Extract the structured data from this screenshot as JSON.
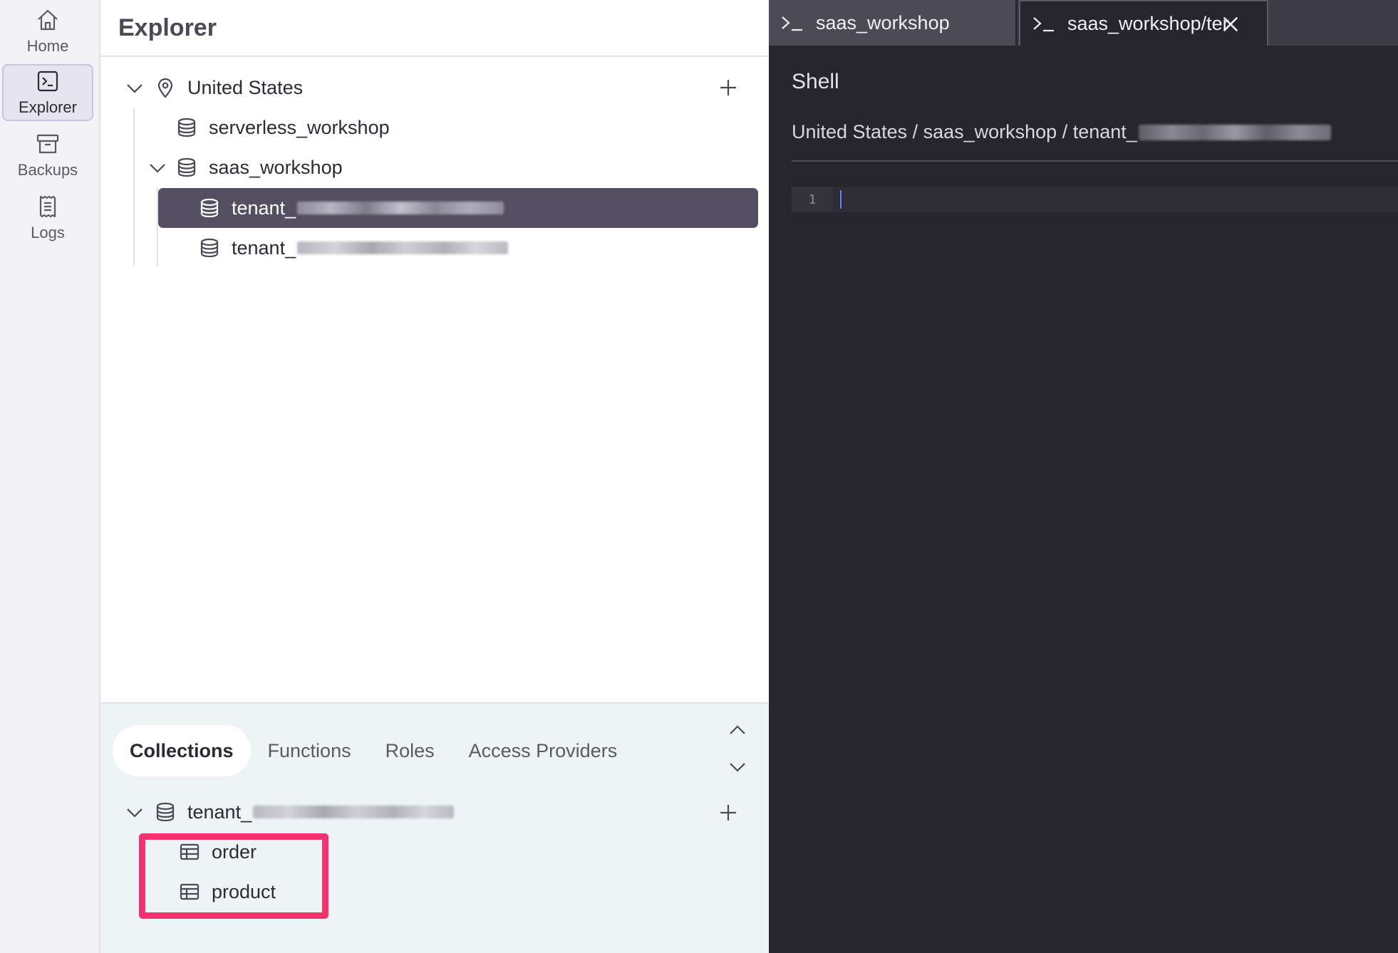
{
  "rail": {
    "items": [
      {
        "label": "Home",
        "icon": "home-icon"
      },
      {
        "label": "Explorer",
        "icon": "terminal-icon",
        "active": true
      },
      {
        "label": "Backups",
        "icon": "archive-icon"
      },
      {
        "label": "Logs",
        "icon": "receipt-icon"
      }
    ]
  },
  "explorer": {
    "title": "Explorer",
    "region": {
      "label": "United States",
      "icon": "location-pin-icon"
    },
    "databases": [
      {
        "label": "serverless_workshop",
        "icon": "database-icon"
      },
      {
        "label": "saas_workshop",
        "icon": "database-icon",
        "expanded": true
      }
    ],
    "tenants": [
      {
        "label": "tenant_",
        "selected": true
      },
      {
        "label": "tenant_",
        "selected": false
      }
    ]
  },
  "bottom": {
    "tabs": [
      "Collections",
      "Functions",
      "Roles",
      "Access Providers"
    ],
    "active_tab": "Collections",
    "db_label": "tenant_",
    "collections": [
      {
        "label": "order",
        "icon": "table-icon"
      },
      {
        "label": "product",
        "icon": "table-icon"
      }
    ],
    "highlight_color": "#f0346f"
  },
  "shell": {
    "tabs": [
      {
        "label": "saas_workshop"
      },
      {
        "label": "saas_workshop/ter"
      }
    ],
    "title": "Shell",
    "breadcrumb": "United States / saas_workshop / tenant_",
    "line_number": "1",
    "background": "#27252d",
    "cursor_color": "#5d87ff"
  }
}
